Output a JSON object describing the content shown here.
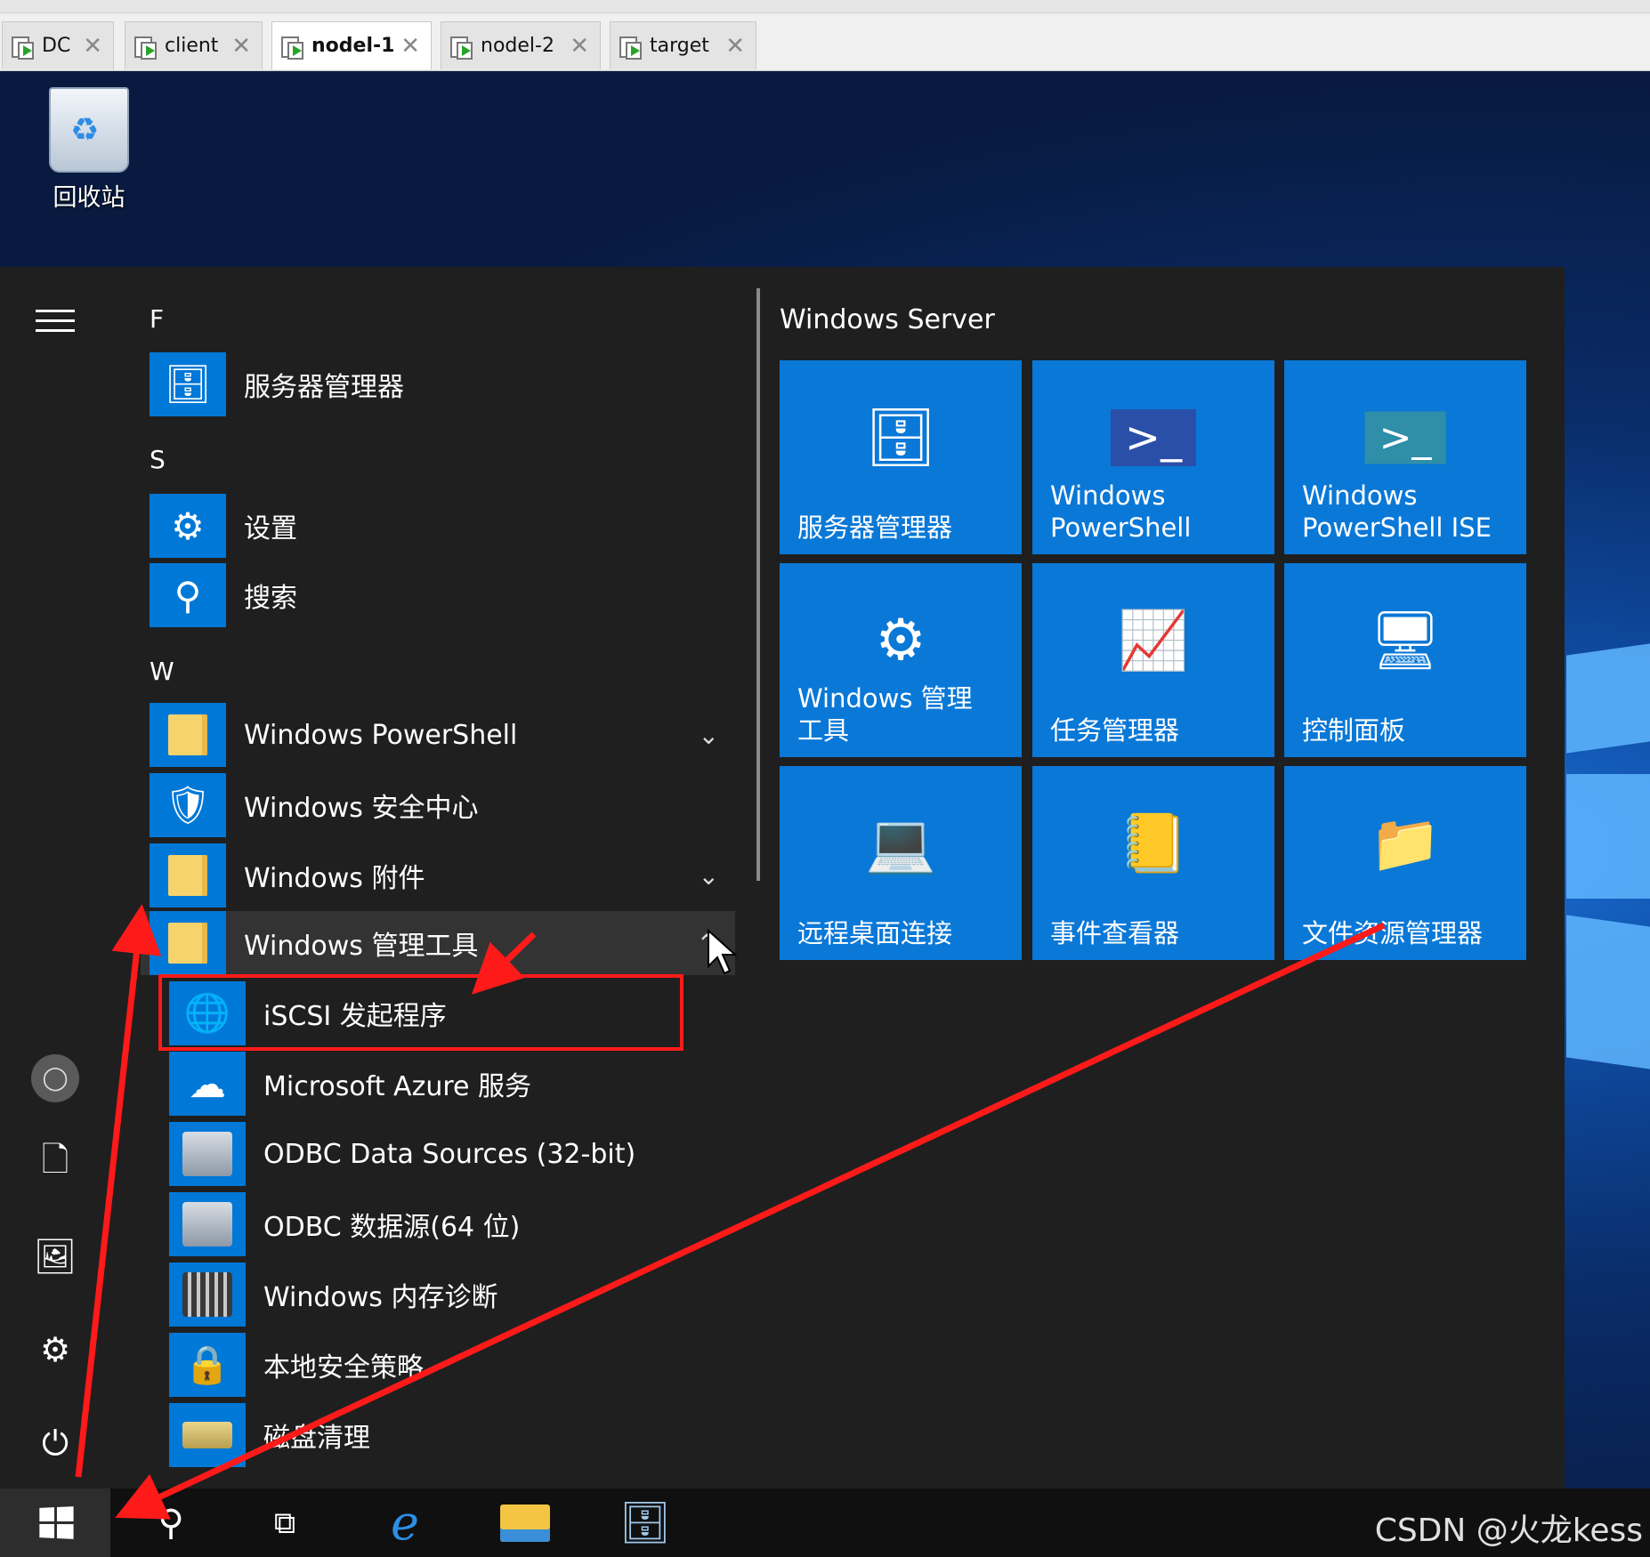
{
  "vm_tabs": [
    {
      "label": "DC",
      "active": false
    },
    {
      "label": "client",
      "active": false
    },
    {
      "label": "nodel-1",
      "active": true
    },
    {
      "label": "nodel-2",
      "active": false
    },
    {
      "label": "target",
      "active": false
    }
  ],
  "desktop": {
    "recycle_bin_label": "回收站"
  },
  "start_menu": {
    "letters": {
      "f": "F",
      "s": "S",
      "w": "W"
    },
    "apps": {
      "server_manager": "服务器管理器",
      "settings": "设置",
      "search": "搜索",
      "powershell_folder": "Windows PowerShell",
      "security_center": "Windows 安全中心",
      "accessories": "Windows 附件",
      "admin_tools": "Windows 管理工具"
    },
    "admin_tools_items": {
      "iscsi": "iSCSI 发起程序",
      "azure": "Microsoft Azure 服务",
      "odbc32": "ODBC Data Sources (32-bit)",
      "odbc64": "ODBC 数据源(64 位)",
      "memdiag": "Windows 内存诊断",
      "secpol": "本地安全策略",
      "cleanup": "磁盘清理"
    },
    "tile_group_title": "Windows Server",
    "tiles": {
      "t1": "服务器管理器",
      "t2": "Windows PowerShell",
      "t3": "Windows PowerShell ISE",
      "t4": "Windows 管理工具",
      "t5": "任务管理器",
      "t6": "控制面板",
      "t7": "远程桌面连接",
      "t8": "事件查看器",
      "t9": "文件资源管理器"
    }
  },
  "taskbar": {
    "watermark": "CSDN @火龙kess"
  },
  "annotations": {
    "arrow_color": "#ff1a1a",
    "highlight_box_color": "#ff1a1a"
  },
  "colors": {
    "tile_blue": "#0a78d7",
    "menu_bg": "#1f1f1f"
  }
}
